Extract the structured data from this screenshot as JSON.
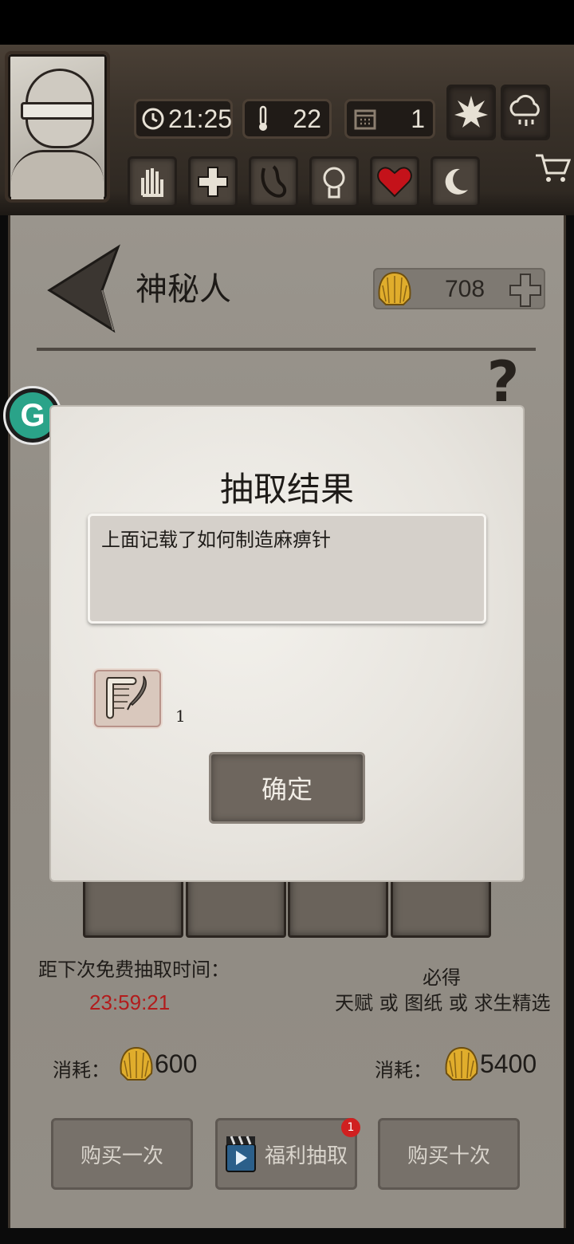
{
  "hud": {
    "time": "21:25",
    "temperature": "22",
    "day": "1",
    "icons": [
      "leaf-icon",
      "rain-icon",
      "hand-icon",
      "health-plus-icon",
      "stomach-icon",
      "brain-icon",
      "heart-icon",
      "moon-icon",
      "cart-icon"
    ]
  },
  "header": {
    "title": "神秘人",
    "coins": "708"
  },
  "dialog": {
    "title": "抽取结果",
    "description": "上面记载了如何制造麻痹针",
    "item_icon": "scroll-quill-icon",
    "item_count": "1",
    "confirm_label": "确定"
  },
  "draw": {
    "free_label": "距下次免费抽取时间：",
    "timer": "23:59:21",
    "guarantee_title": "必得",
    "guarantee_desc": "天赋 或 图纸 或 求生精选",
    "cost_label_single": "消耗：",
    "cost_single": "600",
    "cost_label_ten": "消耗：",
    "cost_ten": "5400",
    "buy_one_label": "购买一次",
    "welfare_label": "福利抽取",
    "welfare_badge": "1",
    "buy_ten_label": "购买十次"
  },
  "colors": {
    "timer": "#b21c1c",
    "badge": "#d02020",
    "assistant": "#2aa389"
  }
}
